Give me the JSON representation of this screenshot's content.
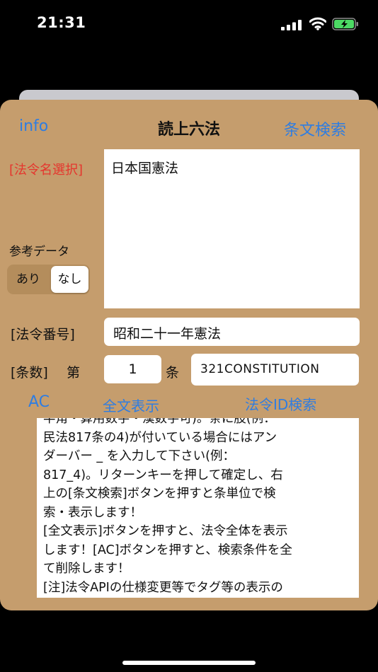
{
  "status_bar": {
    "time": "21:31"
  },
  "nav": {
    "info_label": "info",
    "title": "読上六法",
    "search_label": "条文検索"
  },
  "form": {
    "law_select_label": "[法令名選択]",
    "law_list": [
      "日本国憲法"
    ],
    "reference_label": "参考データ",
    "reference_options": [
      "あり",
      "なし"
    ],
    "reference_selected": "なし",
    "law_number_label": "[法令番号]",
    "law_number_value": "昭和二十一年憲法",
    "article_label": "[条数]",
    "article_prefix": "第",
    "article_value": "1",
    "article_suffix": "条",
    "law_id_value": "321CONSTITUTION"
  },
  "actions": {
    "ac_label": "AC",
    "full_text_label": "全文表示",
    "law_id_search_label": "法令ID検索"
  },
  "help_text": "半角・算用数字・漢数字可)。条に肢(例：\n民法817条の4)が付いている場合にはアン\nダーバー _ を入力して下さい(例：\n817_4)。リターンキーを押して確定し、右\n上の[条文検索]ボタンを押すと条単位で検\n索・表示します！\n[全文表示]ボタンを押すと、法令全体を表示\nします！[AC]ボタンを押すと、検索条件を全\nて削除します！\n[注]法令APIの仕様変更等でタグ等の表示の\n有無・態様が異なることがあります！",
  "colors": {
    "sheet_background": "#c59d6d",
    "link_blue": "#2f7de1",
    "label_red": "#e5352d",
    "battery_green": "#4cd964"
  },
  "icons": [
    "signal-icon",
    "wifi-icon",
    "battery-charging-icon"
  ]
}
